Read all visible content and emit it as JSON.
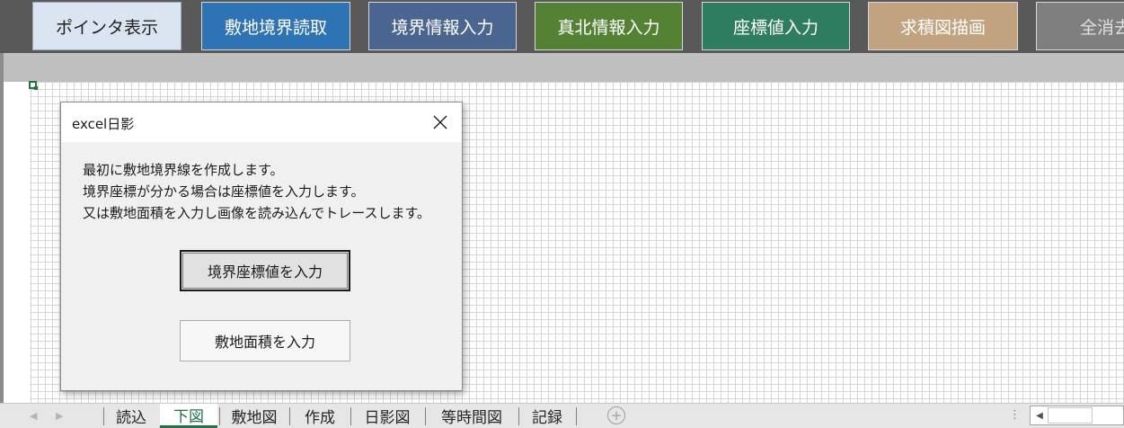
{
  "toolbar": {
    "pointer_label": "ポインタ表示",
    "site_read_label": "敷地境界読取",
    "boundary_info_label": "境界情報入力",
    "north_info_label": "真北情報入力",
    "coord_input_label": "座標値入力",
    "area_draw_label": "求積図描画",
    "clear_all_label": "全消去"
  },
  "dialog": {
    "title": "excel日影",
    "message_lines": [
      "最初に敷地境界線を作成します。",
      "境界座標が分かる場合は座標値を入力します。",
      "又は敷地面積を入力し画像を読み込んでトレースします。"
    ],
    "coord_button_label": "境界座標値を入力",
    "area_button_label": "敷地面積を入力",
    "close_icon": "close-icon"
  },
  "sheet_tabs": [
    "読込",
    "下図",
    "敷地図",
    "作成",
    "日影図",
    "等時間図",
    "記録"
  ],
  "active_sheet": "下図",
  "colors": {
    "pointer": "#dbe5f1",
    "site_read": "#2e74b5",
    "boundary_info": "#4a6590",
    "north_info": "#548235",
    "coord_input": "#2e7d60",
    "area_draw": "#c2a37f",
    "clear_all": "#7f7f7f",
    "excel_green": "#217346"
  }
}
